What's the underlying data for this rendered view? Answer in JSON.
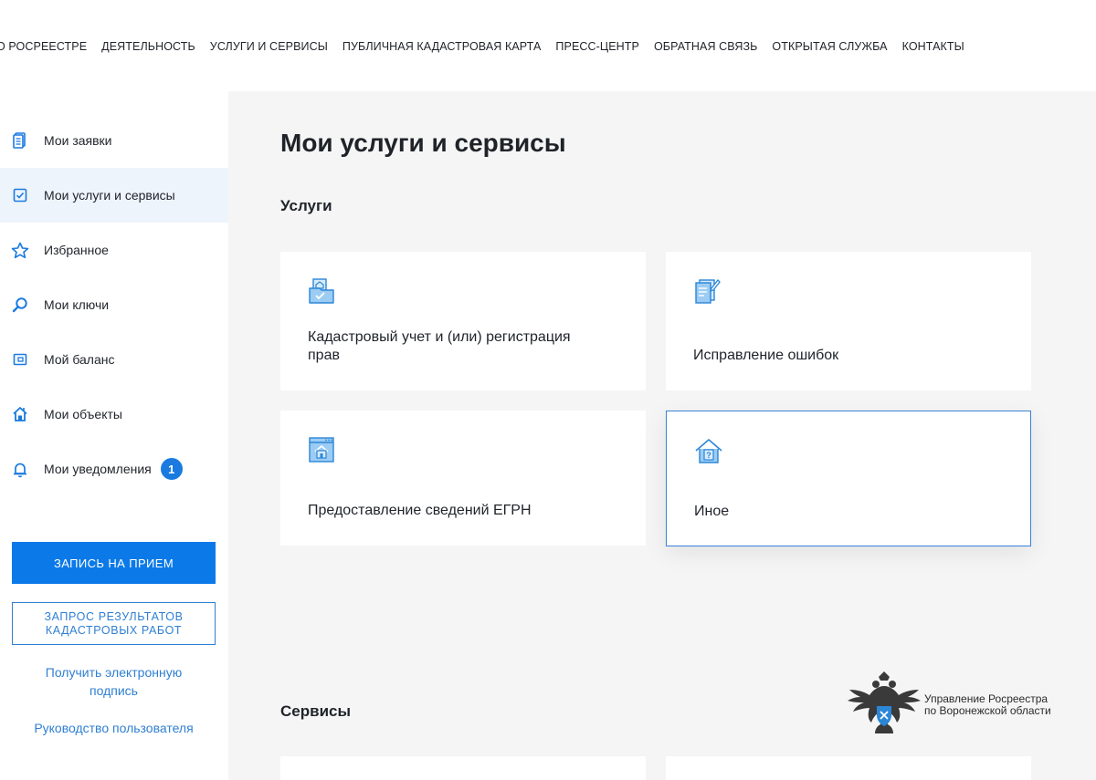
{
  "topnav": {
    "items": [
      "О РОСРЕЕСТРЕ",
      "ДЕЯТЕЛЬНОСТЬ",
      "УСЛУГИ И СЕРВИСЫ",
      "ПУБЛИЧНАЯ КАДАСТРОВАЯ КАРТА",
      "ПРЕСС-ЦЕНТР",
      "ОБРАТНАЯ СВЯЗЬ",
      "ОТКРЫТАЯ СЛУЖБА",
      "КОНТАКТЫ"
    ]
  },
  "sidebar": {
    "items": [
      {
        "label": "Мои заявки",
        "icon": "document-list-icon"
      },
      {
        "label": "Мои услуги и сервисы",
        "icon": "checkbox-icon",
        "active": true
      },
      {
        "label": "Избранное",
        "icon": "star-icon"
      },
      {
        "label": "Мои ключи",
        "icon": "search-icon"
      },
      {
        "label": "Мой баланс",
        "icon": "wallet-icon"
      },
      {
        "label": "Мои объекты",
        "icon": "house-icon"
      },
      {
        "label": "Мои уведомления",
        "icon": "bell-icon",
        "badge": "1"
      }
    ],
    "appointment_button": "ЗАПИСЬ НА ПРИЕМ",
    "request_button_line1": "ЗАПРОС РЕЗУЛЬТАТОВ",
    "request_button_line2": "КАДАСТРОВЫХ РАБОТ",
    "signature_link_line1": "Получить электронную",
    "signature_link_line2": "подпись",
    "guide_link": "Руководство пользователя"
  },
  "main": {
    "title": "Мои услуги и сервисы",
    "services_heading": "Услуги",
    "cards": [
      {
        "line1": "Кадастровый учет и (или) регистрация",
        "line2": "прав",
        "icon": "cadastral-registration-icon"
      },
      {
        "line1": "Исправление ошибок",
        "line2": "",
        "icon": "document-edit-icon"
      },
      {
        "line1": "Предоставление сведений ЕГРН",
        "line2": "",
        "icon": "egrn-window-icon"
      },
      {
        "line1": "Иное",
        "line2": "",
        "icon": "house-question-icon"
      }
    ],
    "tools_heading": "Сервисы"
  },
  "logo": {
    "line1": "Управление Росреестра",
    "line2": "по Воронежской области"
  },
  "colors": {
    "accent": "#0b7ae8",
    "link": "#2f7fd3",
    "badge": "#1a7ae0",
    "active_bg": "#eef4fb",
    "main_bg": "#f5f5f5"
  }
}
